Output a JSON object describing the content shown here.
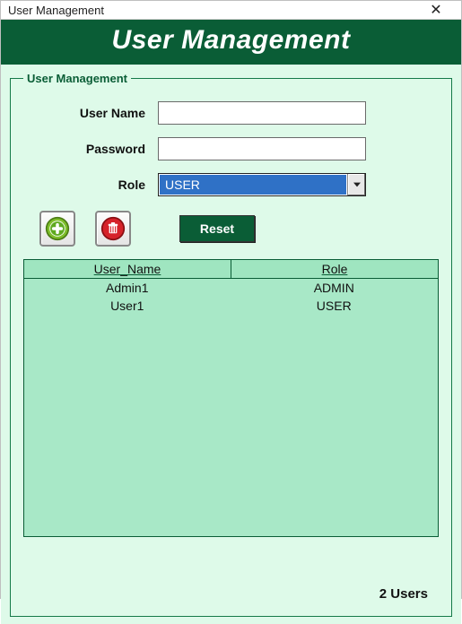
{
  "window": {
    "title": "User Management"
  },
  "banner": {
    "title": "User Management"
  },
  "group": {
    "legend": "User Management"
  },
  "form": {
    "username_label": "User Name",
    "username_value": "",
    "password_label": "Password",
    "password_value": "",
    "role_label": "Role",
    "role_value": "USER"
  },
  "buttons": {
    "add_icon": "add-icon",
    "delete_icon": "trash-icon",
    "reset_label": "Reset"
  },
  "grid": {
    "columns": [
      "User_Name",
      "Role"
    ],
    "rows": [
      {
        "user_name": "Admin1",
        "role": "ADMIN"
      },
      {
        "user_name": "User1",
        "role": "USER"
      }
    ]
  },
  "status": {
    "text": "2 Users"
  }
}
